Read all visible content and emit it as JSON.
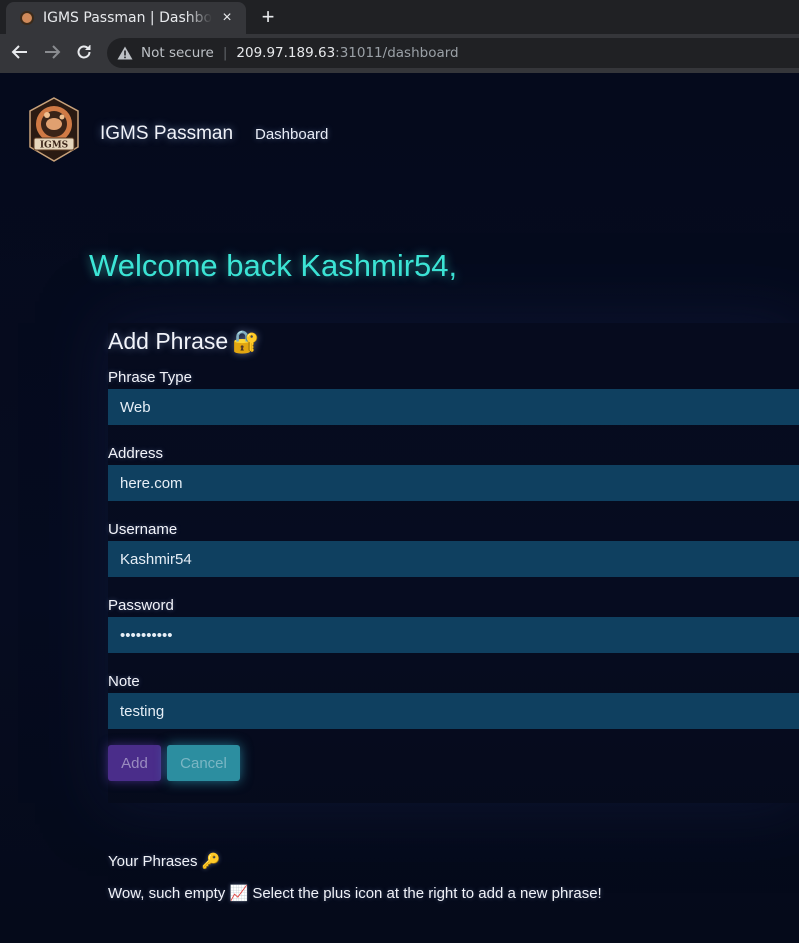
{
  "browser": {
    "tab_title": "IGMS Passman | Dashboard",
    "tab_close": "×",
    "new_tab": "+",
    "security_label": "Not secure",
    "url_host": "209.97.189.63",
    "url_path": ":31011/dashboard",
    "icons": {
      "back": "arrow-left-icon",
      "forward": "arrow-right-icon",
      "reload": "reload-icon",
      "warning": "warning-triangle-icon"
    }
  },
  "navbar": {
    "logo_text": "IGMS",
    "brand": "IGMS Passman",
    "links": [
      {
        "label": "Dashboard"
      }
    ]
  },
  "welcome": "Welcome back Kashmir54,",
  "form": {
    "title": "Add Phrase",
    "title_emoji": "🔐",
    "fields": [
      {
        "label": "Phrase Type",
        "value": "Web"
      },
      {
        "label": "Address",
        "value": "here.com"
      },
      {
        "label": "Username",
        "value": "Kashmir54"
      },
      {
        "label": "Password",
        "value": "••••••••••"
      },
      {
        "label": "Note",
        "value": "testing"
      }
    ],
    "add_button": "Add",
    "cancel_button": "Cancel"
  },
  "phrases": {
    "title": "Your Phrases",
    "title_emoji": "🔑",
    "empty_prefix": "Wow, such empty",
    "empty_emoji": "📈",
    "empty_suffix": "Select the plus icon at the right to add a new phrase!"
  },
  "colors": {
    "page_bg": "#050a1c",
    "welcome": "#3de8d8",
    "input_bg": "#0f4060",
    "add_button": "#4a2d8a",
    "cancel_button": "#2c8ea0"
  }
}
